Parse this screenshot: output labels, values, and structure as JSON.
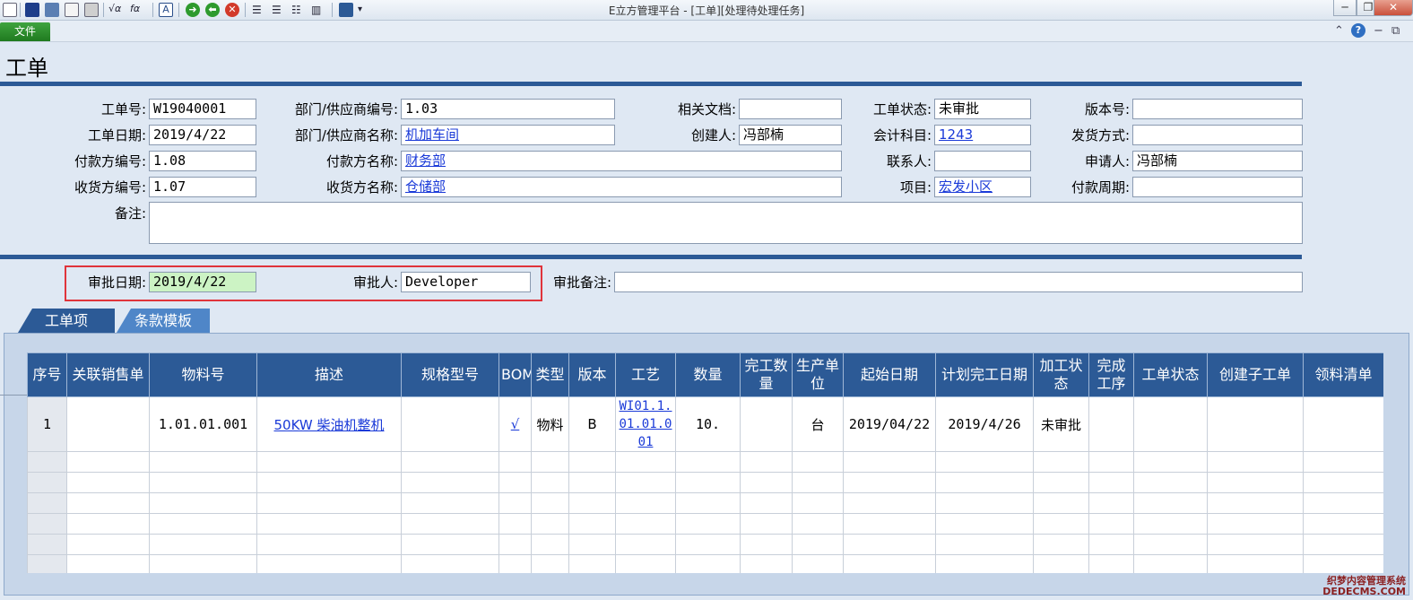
{
  "window": {
    "title": "E立方管理平台 - [工单][处理待处理任务]",
    "minimize": "─",
    "restore": "❐",
    "close": "✕"
  },
  "menubar": {
    "file_label": "文件",
    "collapse": "⌃",
    "help": "?",
    "min": "−",
    "restore": "⧉"
  },
  "page": {
    "title": "工单"
  },
  "form": {
    "order_no_label": "工单号:",
    "order_no": "W19040001",
    "dept_code_label": "部门/供应商编号:",
    "dept_code": "1.03",
    "related_doc_label": "相关文档:",
    "related_doc": "",
    "order_status_label": "工单状态:",
    "order_status": "未审批",
    "version_label": "版本号:",
    "version": "",
    "order_date_label": "工单日期:",
    "order_date": "2019/4/22",
    "dept_name_label": "部门/供应商名称:",
    "dept_name": "机加车间",
    "creator_label": "创建人:",
    "creator": "冯部楠",
    "account_label": "会计科目:",
    "account": "1243",
    "ship_method_label": "发货方式:",
    "ship_method": "",
    "payer_code_label": "付款方编号:",
    "payer_code": "1.08",
    "payer_name_label": "付款方名称:",
    "payer_name": "财务部",
    "contact_label": "联系人:",
    "contact": "",
    "applicant_label": "申请人:",
    "applicant": "冯部楠",
    "receiver_code_label": "收货方编号:",
    "receiver_code": "1.07",
    "receiver_name_label": "收货方名称:",
    "receiver_name": "仓储部",
    "project_label": "项目:",
    "project": "宏发小区",
    "pay_period_label": "付款周期:",
    "pay_period": "",
    "remark_label": "备注:",
    "remark": ""
  },
  "approval": {
    "date_label": "审批日期:",
    "date": "2019/4/22",
    "approver_label": "审批人:",
    "approver": "Developer",
    "remark_label": "审批备注:",
    "remark": ""
  },
  "tabs": [
    {
      "label": "工单项"
    },
    {
      "label": "条款模板"
    }
  ],
  "grid": {
    "headers": [
      "序号",
      "关联销售单",
      "物料号",
      "描述",
      "规格型号",
      "BOM",
      "类型",
      "版本",
      "工艺",
      "数量",
      "完工数量",
      "生产单位",
      "起始日期",
      "计划完工日期",
      "加工状态",
      "完成工序",
      "工单状态",
      "创建子工单",
      "领料清单"
    ],
    "row": {
      "seq": "1",
      "sales_order": "",
      "material_no": "1.01.01.001",
      "description": "50KW 柴油机整机",
      "spec": "",
      "bom": "√",
      "type": "物料",
      "version": "B",
      "craft": "WI01.1.01.01.001",
      "quantity": "10.",
      "done_qty": "",
      "unit": "台",
      "start_date": "2019/04/22",
      "plan_date": "2019/4/26",
      "process_status": "未审批",
      "done_step": "",
      "order_status": "",
      "create_sub": "",
      "pick_list": ""
    }
  },
  "watermark": {
    "line1": "织梦内容管理系统",
    "line2": "DEDECMS.COM"
  }
}
